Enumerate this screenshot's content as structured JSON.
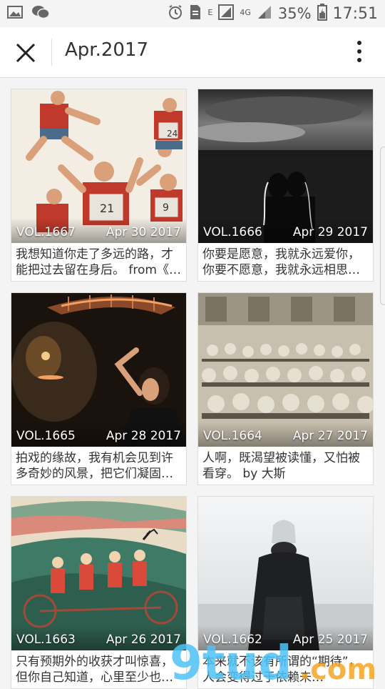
{
  "status_bar": {
    "network_label": "E",
    "signal_label": "4G",
    "battery_percent": "35%",
    "time": "17:51"
  },
  "header": {
    "title": "Apr.2017"
  },
  "cards": [
    {
      "vol": "VOL.1667",
      "date": "Apr 30 2017",
      "excerpt": "我想知道你走了多远的路，才能把过去留在身后。 from《…"
    },
    {
      "vol": "VOL.1666",
      "date": "Apr 29 2017",
      "excerpt": "你要是愿意，我就永远爱你，你要不愿意，我就永远相思…"
    },
    {
      "vol": "VOL.1665",
      "date": "Apr 28 2017",
      "excerpt": "拍戏的缘故，我有机会见到许多奇妙的风景，把它们凝固…"
    },
    {
      "vol": "VOL.1664",
      "date": "Apr 27 2017",
      "excerpt": "人啊，既渴望被读懂，又怕被看穿。 by 大斯"
    },
    {
      "vol": "VOL.1663",
      "date": "Apr 26 2017",
      "excerpt": "只有预期外的收获才叫惊喜，但你自己知道，心里至少也…"
    },
    {
      "vol": "VOL.1662",
      "date": "Apr 25 2017",
      "excerpt": "本来就不该有所谓的“期待”，人会变得过于依赖未…"
    }
  ],
  "colors": {
    "accent_watermark": "#4fc3f7",
    "accent_watermark_2": "#f5a623"
  },
  "watermark_text": "9tud.com"
}
